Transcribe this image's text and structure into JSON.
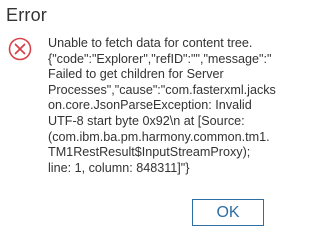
{
  "dialog": {
    "title": "Error",
    "message": "Unable to fetch data for content tree.\n{\"code\":\"Explorer\",\"refID\":\"\",\"message\":\"\nFailed to get children for Server\nProcesses\",\"cause\":\"com.fasterxml.jacks\non.core.JsonParseException: Invalid\nUTF-8 start byte 0x92\\n at [Source:\n(com.ibm.ba.pm.harmony.common.tm1.\nTM1RestResult$InputStreamProxy);\nline: 1, column: 848311]\"}",
    "ok_label": "OK",
    "icon": "error-circle-x-icon"
  },
  "colors": {
    "error_icon": "#d7434a",
    "button_accent": "#2d6ea3",
    "text": "#333333"
  }
}
